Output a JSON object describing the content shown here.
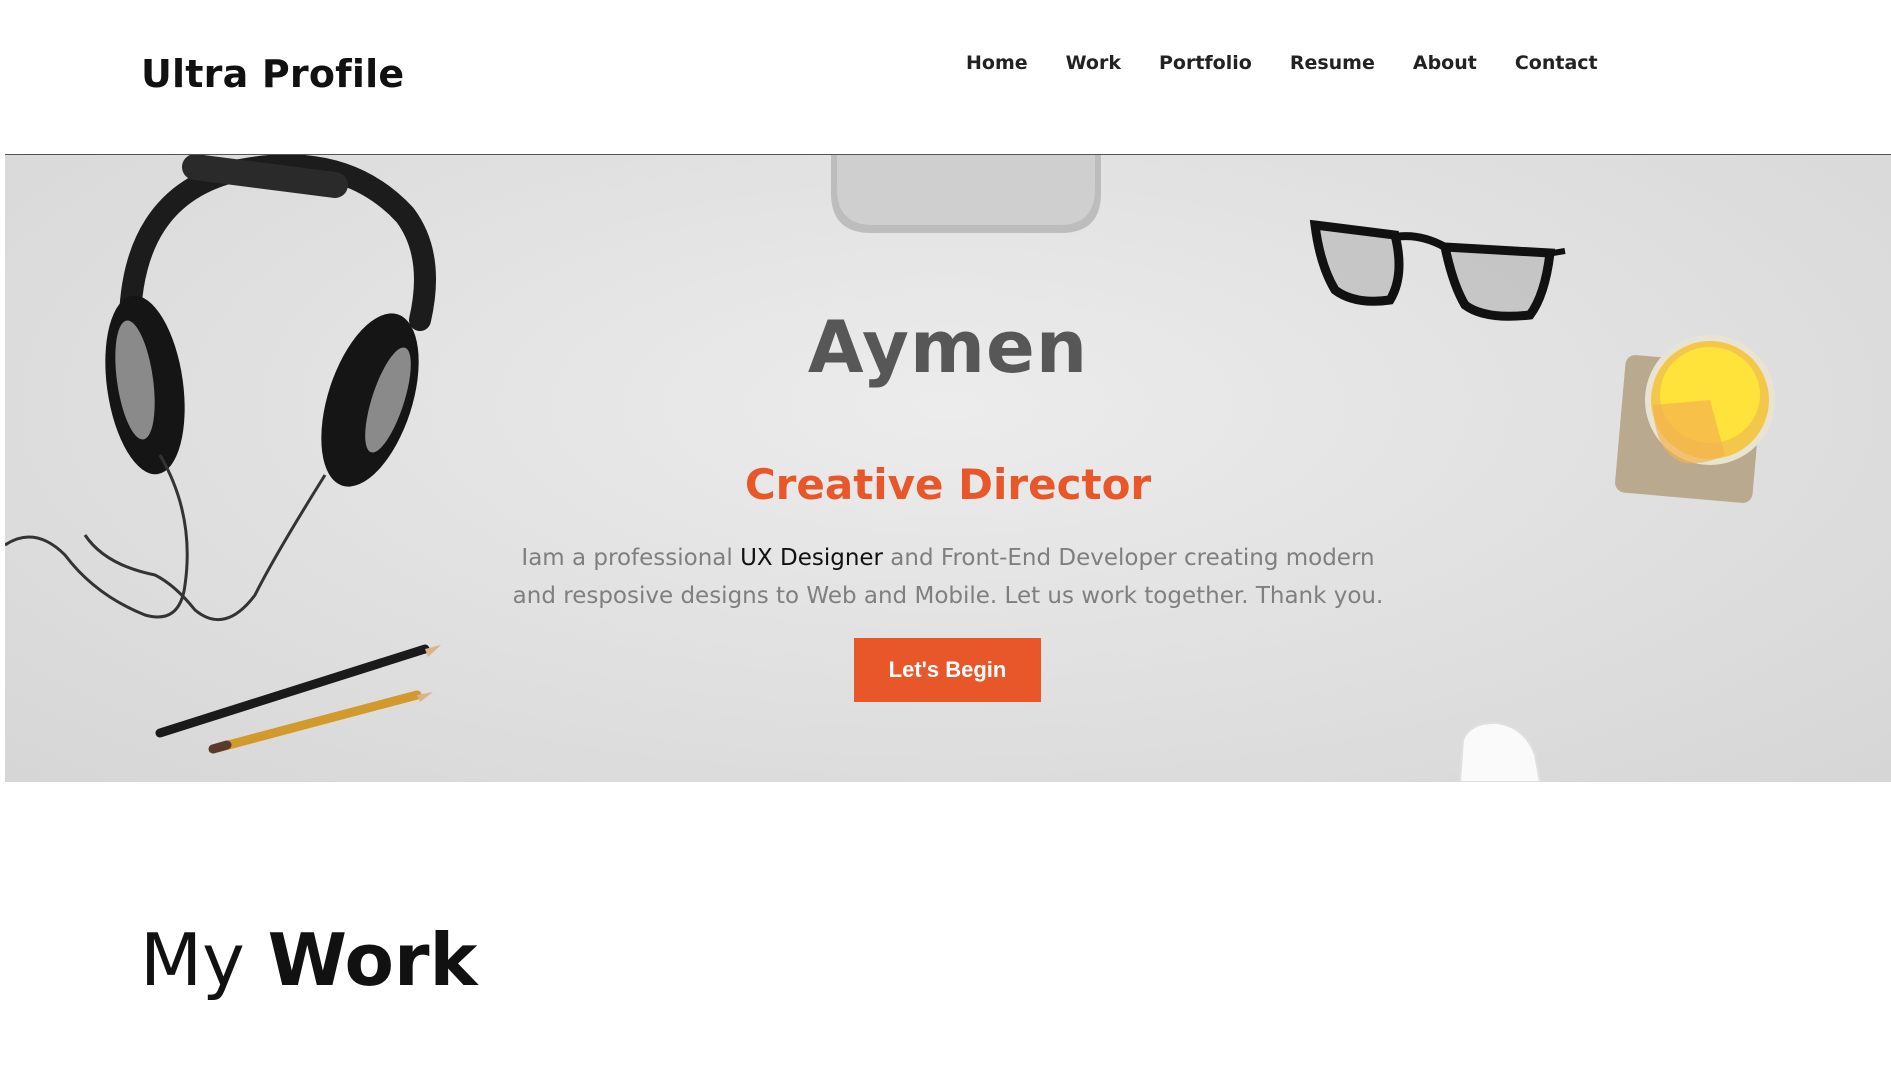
{
  "header": {
    "brand": "Ultra Profile",
    "nav": [
      "Home",
      "Work",
      "Portfolio",
      "Resume",
      "About",
      "Contact"
    ]
  },
  "hero": {
    "name": "Aymen",
    "role": "Creative Director",
    "desc_before": "Iam a professional ",
    "desc_highlight": "UX Designer",
    "desc_after": " and Front-End Developer creating modern and resposive designs to Web and Mobile. Let us work together. Thank you.",
    "cta_label": "Let's Begin"
  },
  "section": {
    "title_light": "My ",
    "title_bold": "Work"
  },
  "colors": {
    "accent": "#e8572a",
    "name_gray": "#575757",
    "desc_gray": "#7f7f7f"
  }
}
